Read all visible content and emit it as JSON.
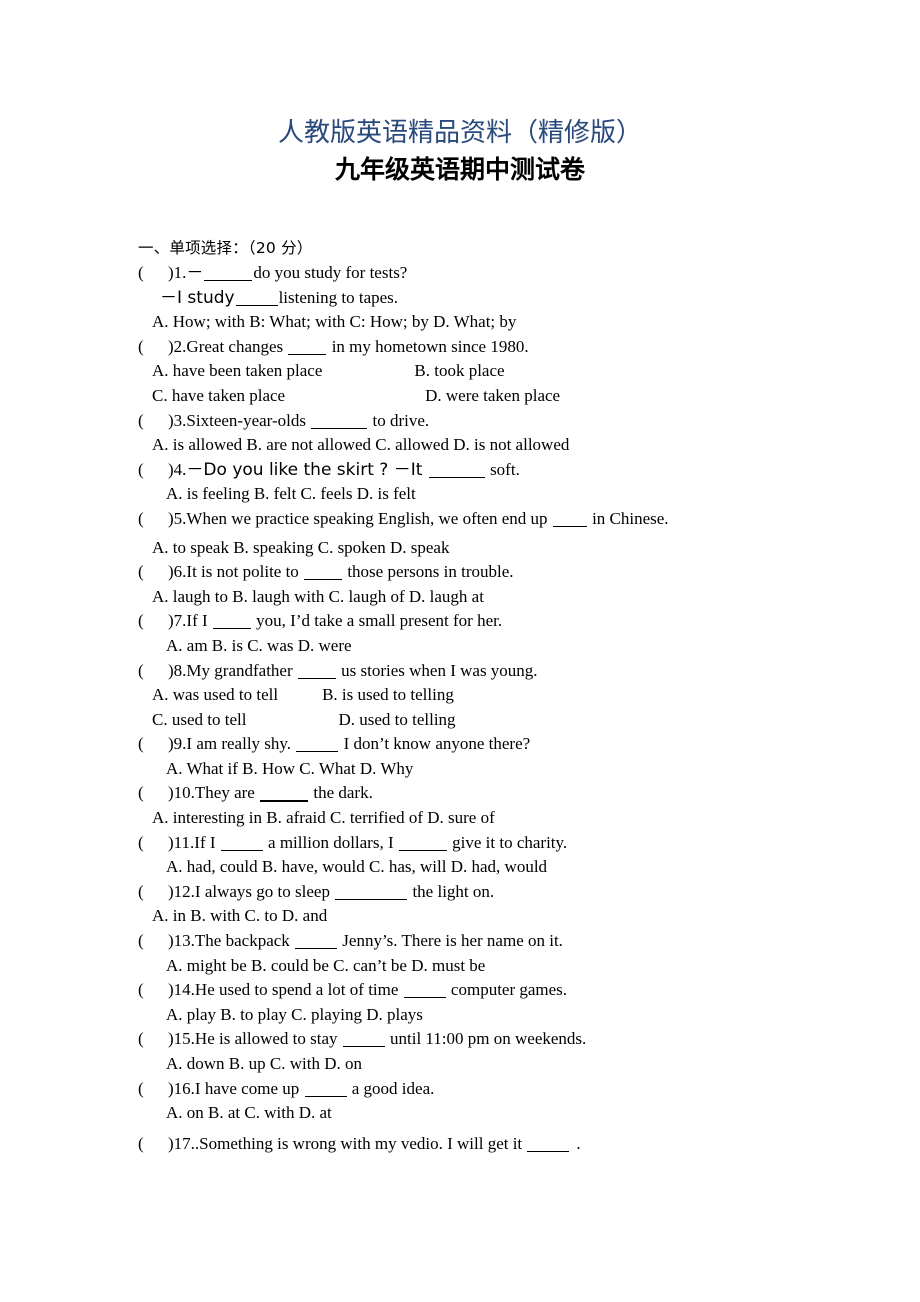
{
  "document": {
    "header_blue": "人教版英语精品资料（精修版）",
    "title": "九年级英语期中测试卷",
    "header_color": "#28497B",
    "body_color": "#000000",
    "page_background": "#FFFFFF"
  },
  "section": {
    "heading": "一、单项选择：（20 分）",
    "bracket": "(",
    "bracket_close": ")"
  },
  "questions": [
    {
      "number": "1.",
      "stem_prefix": "－",
      "stem_suffix": "do you study for tests?",
      "continuation": "－I study",
      "continuation_suffix": "listening to tapes.",
      "options_line1": "A. How; with   B: What; with     C: How; by     D. What; by"
    },
    {
      "number": "2.",
      "stem_prefix": "Great changes ",
      "stem_suffix": " in my hometown since 1980.",
      "options_line1_a": "A. have been taken place",
      "options_line1_b": "B. took place",
      "options_line2_a": "C. have taken place",
      "options_line2_b": "D. were taken place"
    },
    {
      "number": "3.",
      "stem_prefix": "Sixteen-year-olds ",
      "stem_suffix": " to drive.",
      "options_line1": "A. is allowed        B. are not allowed    C. allowed      D. is not allowed"
    },
    {
      "number": "4.",
      "stem_prefix": "－Do you like the skirt ?  －It ",
      "stem_suffix": " soft.",
      "options_line1": "A. is feeling         B. felt                  C. feels                  D. is felt"
    },
    {
      "number": "5.",
      "stem_prefix": "When we practice speaking English, we often end up ",
      "stem_suffix": " in Chinese.",
      "options_line1": "A. to speak     B. speaking     C. spoken     D. speak"
    },
    {
      "number": "6.",
      "stem_prefix": "It is not polite to ",
      "stem_suffix": " those persons in trouble.",
      "options_line1": "A. laugh to      B. laugh with      C. laugh of      D. laugh at"
    },
    {
      "number": "7.",
      "stem_prefix": "If I ",
      "stem_suffix": " you, I’d take a small present for her.",
      "options_line1": "A. am              B. is                  C. was                D. were"
    },
    {
      "number": "8.",
      "stem_prefix": "My grandfather ",
      "stem_suffix": " us stories when I was young.",
      "options_line1_a": "A. was used to tell",
      "options_line1_b": "B. is used to telling",
      "options_line2_a": "C. used to tell",
      "options_line2_b": "D. used to telling"
    },
    {
      "number": "9.",
      "stem_prefix": "I am really shy. ",
      "stem_suffix": " I don’t know anyone there?",
      "options_line1": "A. What if          B. How            C. What             D. Why"
    },
    {
      "number": "10.",
      "stem_prefix": "They are ",
      "stem_suffix": " the dark.",
      "options_line1": "A. interesting in     B. afraid     C. terrified of     D. sure of"
    },
    {
      "number": "11.",
      "stem_prefix": "If I ",
      "stem_mid": " a million dollars, I ",
      "stem_suffix": " give it to charity.",
      "options_line1": "A. had, could        B. have, would        C. has, will    D. had, would"
    },
    {
      "number": "12.",
      "stem_prefix": "I always go to sleep ",
      "stem_suffix": " the light on.",
      "options_line1": "A. in                    B. with                   C. to                      D. and"
    },
    {
      "number": "13.",
      "stem_prefix": "The backpack ",
      "stem_suffix": " Jenny’s. There is her name on it.",
      "options_line1": "A. might be      B. could be      C. can’t be      D. must be"
    },
    {
      "number": "14.",
      "stem_prefix": "He used to spend a lot of time ",
      "stem_suffix": " computer games.",
      "options_line1": "A. play                B. to play           C. playing        D. plays"
    },
    {
      "number": "15.",
      "stem_prefix": "He is allowed to stay ",
      "stem_suffix": " until 11:00 pm on weekends.",
      "options_line1": "A. down               B. up                   C. with               D. on"
    },
    {
      "number": "16.",
      "stem_prefix": "I have come up ",
      "stem_suffix": " a good idea.",
      "options_line1": "A. on                   B. at                     C. with                 D. at"
    },
    {
      "number": "17.",
      "stem_prefix": ".Something is wrong with my vedio. I will get it ",
      "stem_suffix": "."
    }
  ]
}
